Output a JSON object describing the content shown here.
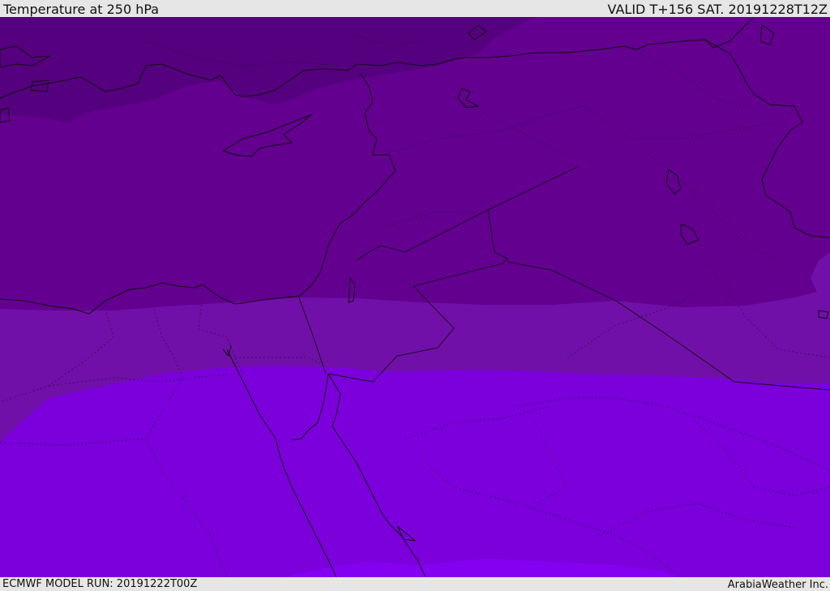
{
  "header": {
    "title": "Temperature at 250 hPa",
    "valid": "VALID T+156 SAT. 20191228T12Z"
  },
  "footer": {
    "model_run": "ECMWF MODEL RUN: 20191222T00Z",
    "credit": "ArabiaWeather Inc."
  },
  "colors": {
    "band_darkest": "#55007e",
    "band_dark": "#630090",
    "band_medium": "#7010a8",
    "band_bright": "#7b00dc",
    "band_brightest": "#8500f0"
  },
  "map": {
    "region": "Eastern Mediterranean, Levant, Egypt, Arabia",
    "field": "temperature",
    "level": "250 hPa"
  }
}
